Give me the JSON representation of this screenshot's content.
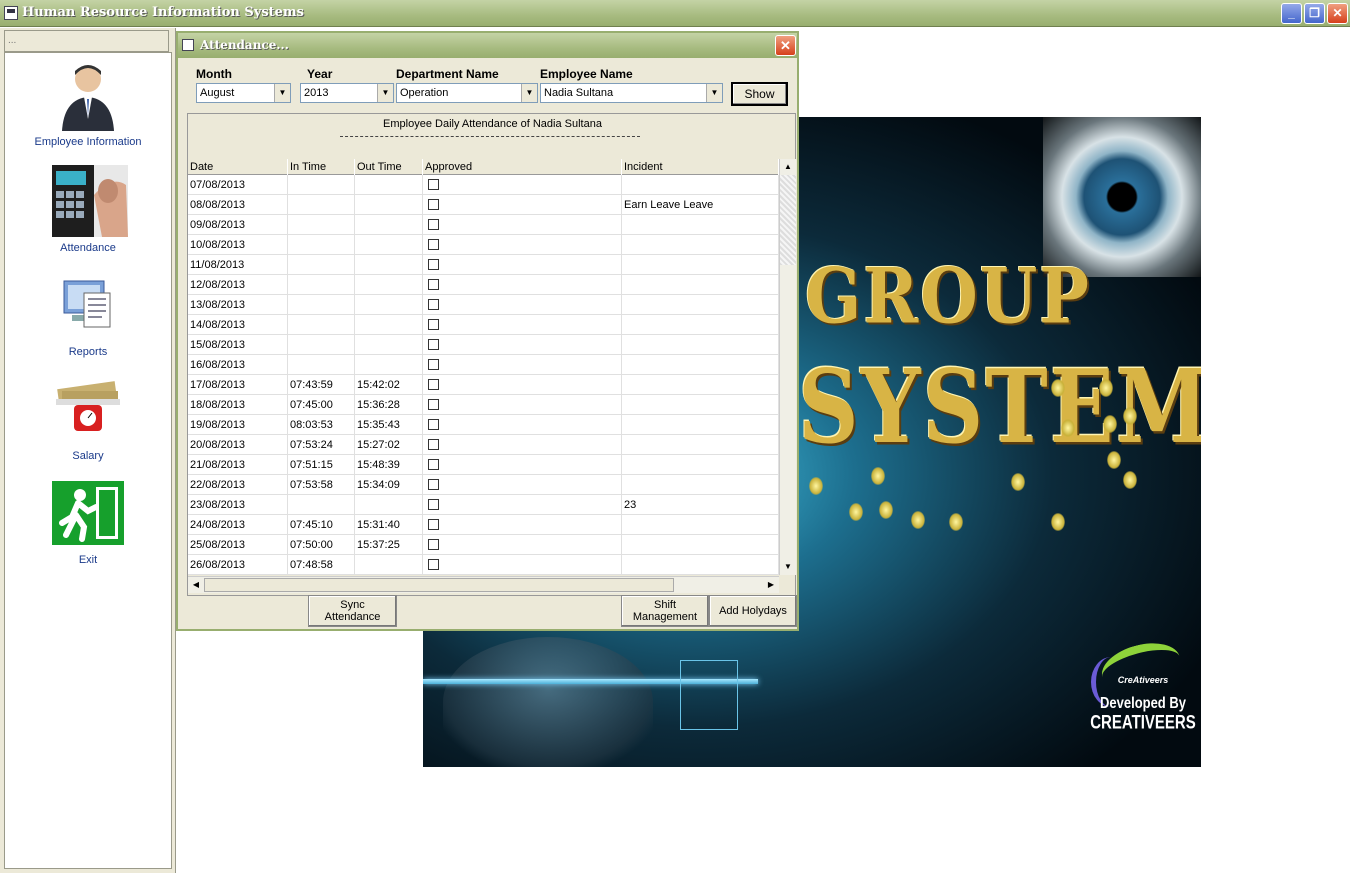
{
  "app": {
    "title": "Human Resource Information Systems"
  },
  "window_controls": {
    "minimize": "_",
    "maximize": "❐",
    "close": "✕"
  },
  "left_panel": {
    "header": "...",
    "items": [
      {
        "label": "Employee Information",
        "icon": "employee-icon"
      },
      {
        "label": "Attendance",
        "icon": "fingerprint-keypad-icon"
      },
      {
        "label": "Reports",
        "icon": "reports-icon"
      },
      {
        "label": "Salary",
        "icon": "salary-scale-icon"
      },
      {
        "label": "Exit",
        "icon": "exit-door-icon"
      }
    ]
  },
  "splash": {
    "line1": "GROUP",
    "line2": "SYSTEM",
    "brand": "CreAtiveers",
    "developed_by": "Developed By",
    "developer": "CREATIVEERS"
  },
  "attendance": {
    "title": "Attendance...",
    "close": "✕",
    "filters": {
      "month_label": "Month",
      "month_value": "August",
      "year_label": "Year",
      "year_value": "2013",
      "dept_label": "Department Name",
      "dept_value": "Operation",
      "emp_label": "Employee Name",
      "emp_value": "Nadia Sultana"
    },
    "show_label": "Show",
    "grid_caption": "Employee Daily Attendance of Nadia Sultana",
    "columns": [
      "Date",
      "In Time",
      "Out Time",
      "Approved",
      "Incident"
    ],
    "rows": [
      {
        "date": "07/08/2013",
        "in": "",
        "out": "",
        "incident": ""
      },
      {
        "date": "08/08/2013",
        "in": "",
        "out": "",
        "incident": "Earn Leave Leave"
      },
      {
        "date": "09/08/2013",
        "in": "",
        "out": "",
        "incident": ""
      },
      {
        "date": "10/08/2013",
        "in": "",
        "out": "",
        "incident": ""
      },
      {
        "date": "11/08/2013",
        "in": "",
        "out": "",
        "incident": ""
      },
      {
        "date": "12/08/2013",
        "in": "",
        "out": "",
        "incident": ""
      },
      {
        "date": "13/08/2013",
        "in": "",
        "out": "",
        "incident": ""
      },
      {
        "date": "14/08/2013",
        "in": "",
        "out": "",
        "incident": ""
      },
      {
        "date": "15/08/2013",
        "in": "",
        "out": "",
        "incident": ""
      },
      {
        "date": "16/08/2013",
        "in": "",
        "out": "",
        "incident": ""
      },
      {
        "date": "17/08/2013",
        "in": "07:43:59",
        "out": "15:42:02",
        "incident": ""
      },
      {
        "date": "18/08/2013",
        "in": "07:45:00",
        "out": "15:36:28",
        "incident": ""
      },
      {
        "date": "19/08/2013",
        "in": "08:03:53",
        "out": "15:35:43",
        "incident": ""
      },
      {
        "date": "20/08/2013",
        "in": "07:53:24",
        "out": "15:27:02",
        "incident": ""
      },
      {
        "date": "21/08/2013",
        "in": "07:51:15",
        "out": "15:48:39",
        "incident": ""
      },
      {
        "date": "22/08/2013",
        "in": "07:53:58",
        "out": "15:34:09",
        "incident": ""
      },
      {
        "date": "23/08/2013",
        "in": "",
        "out": "",
        "incident": "23"
      },
      {
        "date": "24/08/2013",
        "in": "07:45:10",
        "out": "15:31:40",
        "incident": ""
      },
      {
        "date": "25/08/2013",
        "in": "07:50:00",
        "out": "15:37:25",
        "incident": ""
      },
      {
        "date": "26/08/2013",
        "in": "07:48:58",
        "out": "",
        "incident": ""
      }
    ],
    "buttons": {
      "sync_line1": "Sync",
      "sync_line2": "Attendance",
      "shift_line1": "Shift",
      "shift_line2": "Management",
      "holydays": "Add Holydays"
    }
  }
}
